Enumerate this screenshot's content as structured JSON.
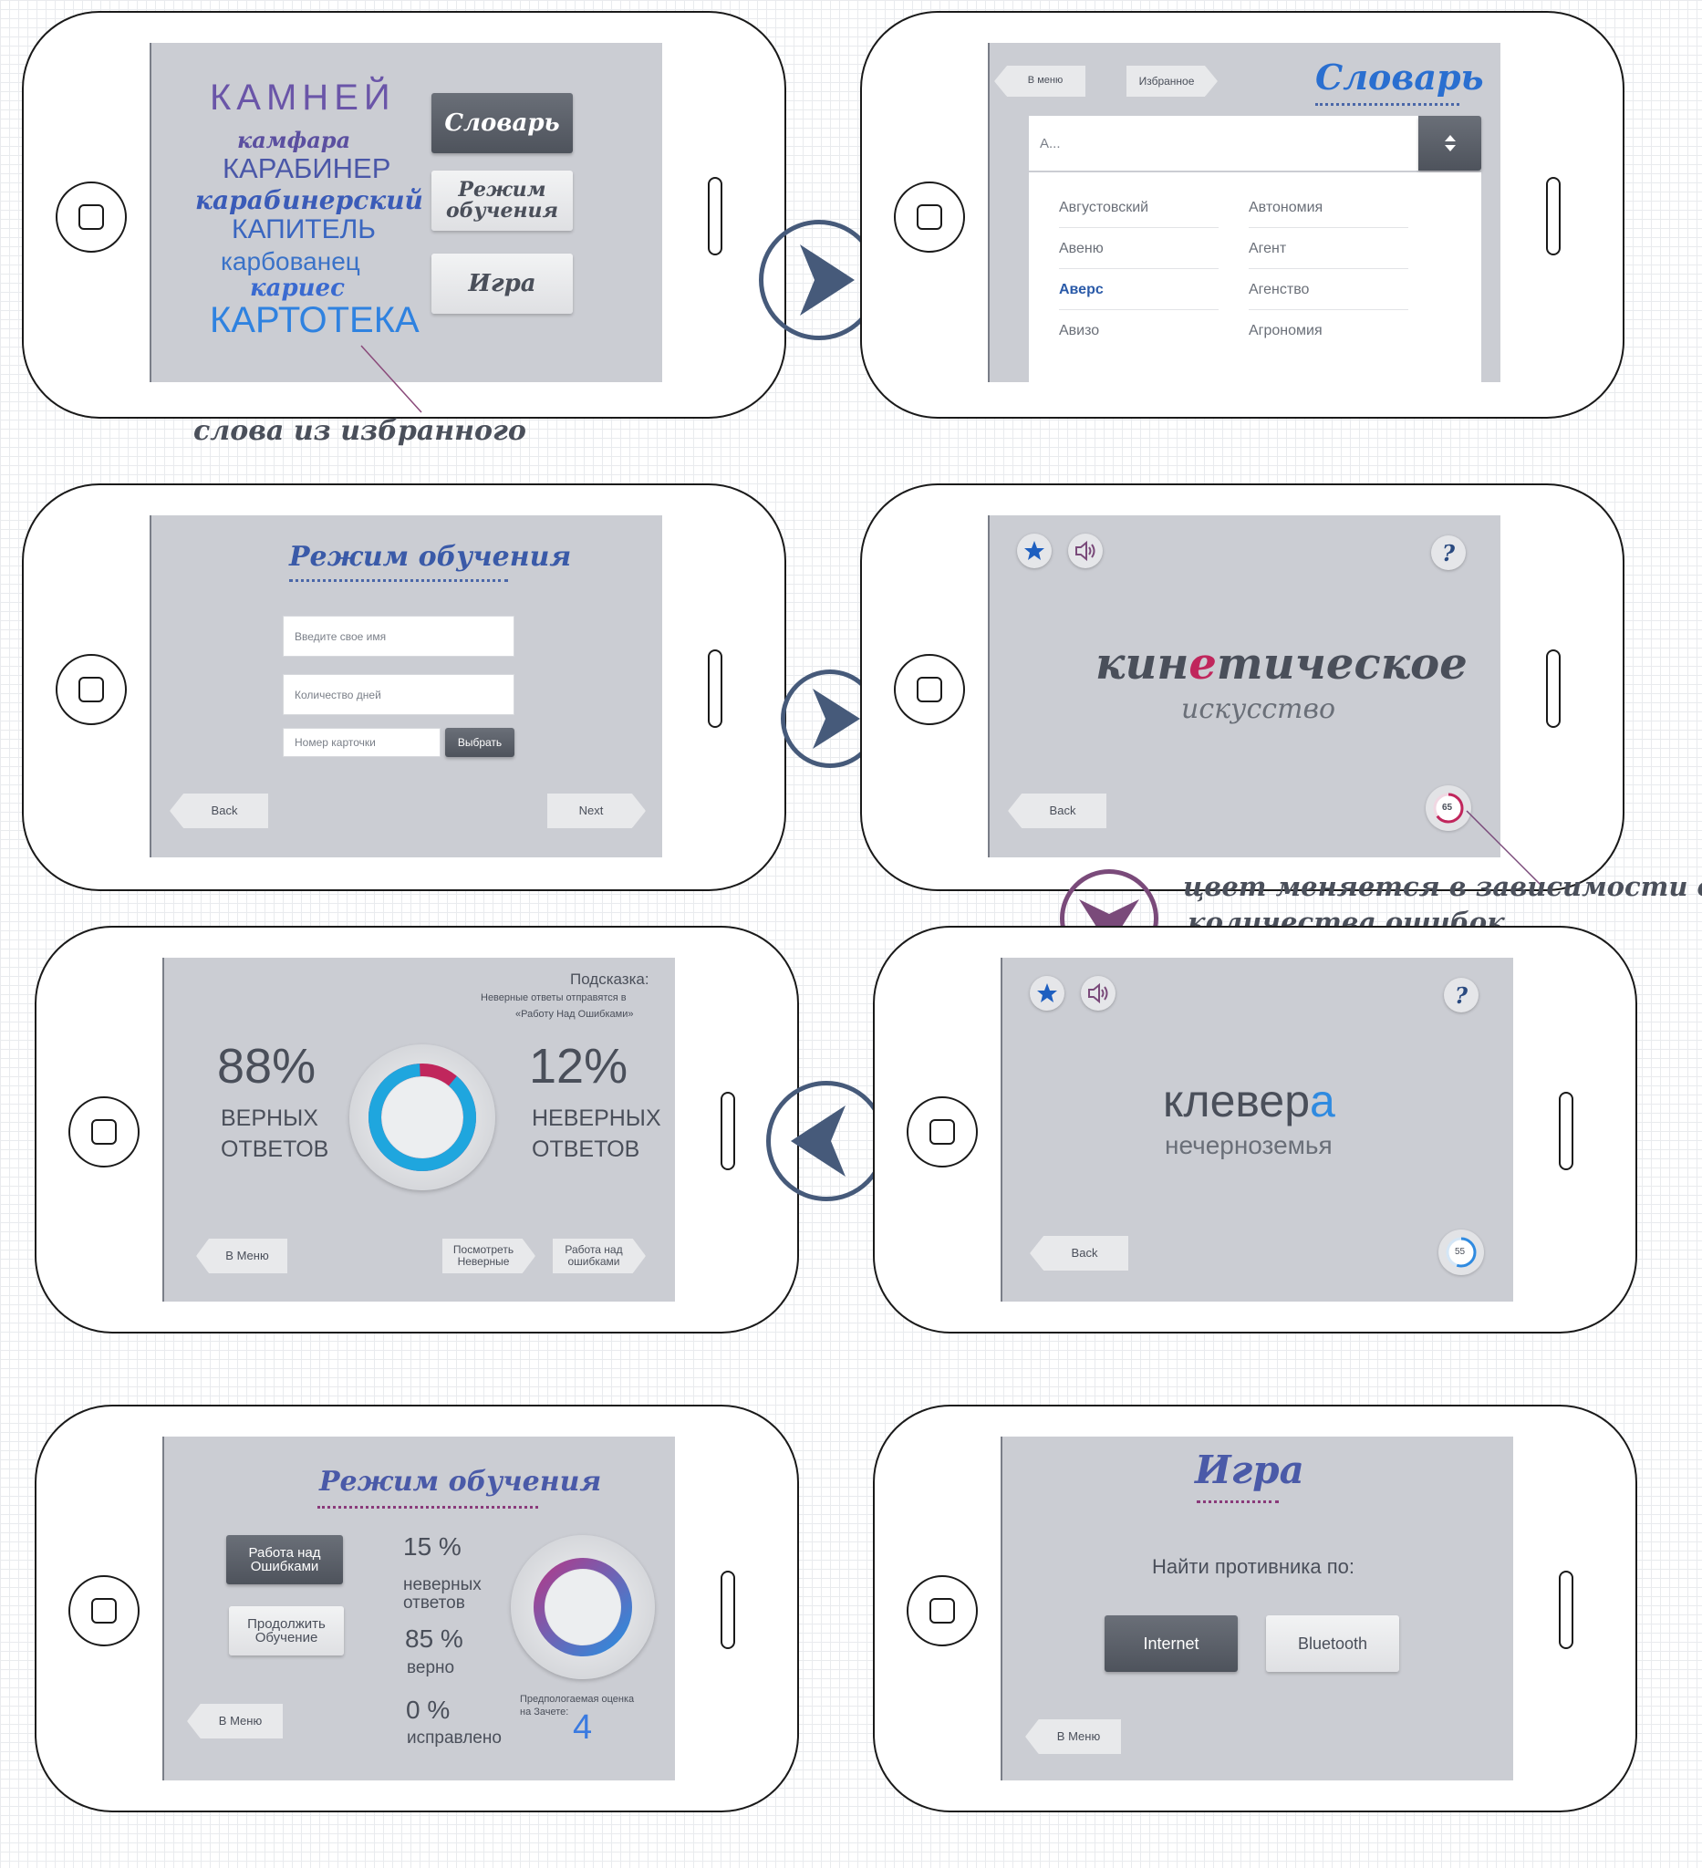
{
  "colors": {
    "screen_bg": "#cbcdd3",
    "accent_blue": "#2a6fd0",
    "dark_navy": "#465a7a",
    "crimson": "#c0265c",
    "purple": "#7a4a7a"
  },
  "annotations": {
    "favorites_note": "слова из избранного",
    "color_note_line1": "цвет меняется в зависимости от",
    "color_note_line2": "количества ошибок"
  },
  "screen1": {
    "words": [
      "КАМНЕЙ",
      "камфара",
      "КАРАБИНЕР",
      "карабинерский",
      "КАПИТЕЛЬ",
      "карбованец",
      "кариес",
      "КАРТОТЕКА"
    ],
    "dictionary_button": "Словарь",
    "learning_button_line1": "Режим",
    "learning_button_line2": "обучения",
    "game_button": "Игра"
  },
  "screen2": {
    "menu_button": "В меню",
    "favorites_button": "Избранное",
    "title": "Словарь",
    "search_value": "А...",
    "sort_icon": "sort-updown-icon",
    "col1": [
      "Августовский",
      "Авеню",
      "Аверс",
      "Авизо"
    ],
    "col2": [
      "Автономия",
      "Агент",
      "Агенство",
      "Агрономия"
    ],
    "selected": "Аверс"
  },
  "screen3": {
    "title": "Режим обучения",
    "name_placeholder": "Введите свое имя",
    "days_placeholder": "Количество дней",
    "card_placeholder": "Номер карточки",
    "choose_button": "Выбрать",
    "back_button": "Back",
    "next_button": "Next"
  },
  "screen4": {
    "word_part1": "кин",
    "word_highlight": "е",
    "word_part2": "тическое",
    "subword": "искусство",
    "help": "?",
    "back_button": "Back",
    "progress_value": "65",
    "progress_fraction": 0.65
  },
  "screen5": {
    "hint_title": "Подсказка:",
    "hint_line1": "Неверные ответы отправятся в",
    "hint_line2": "«Работу Над Ошибками»",
    "correct_percent": "88%",
    "correct_label_line1": "ВЕРНЫХ",
    "correct_label_line2": "ОТВЕТОВ",
    "wrong_percent": "12%",
    "wrong_label_line1": "НЕВЕРНЫХ",
    "wrong_label_line2": "ОТВЕТОВ",
    "correct_fraction": 0.88,
    "menu_button": "В Меню",
    "view_wrong_line1": "Посмотреть",
    "view_wrong_line2": "Неверные",
    "work_errors_line1": "Работа над",
    "work_errors_line2": "ошибками"
  },
  "screen6": {
    "word_part1": "клевер",
    "word_highlight": "а",
    "subword": "нечерноземья",
    "help": "?",
    "back_button": "Back",
    "progress_value": "55",
    "progress_fraction": 0.55
  },
  "screen7": {
    "title": "Режим обучения",
    "work_errors_line1": "Работа над",
    "work_errors_line2": "Ошибками",
    "continue_line1": "Продолжить",
    "continue_line2": "Обучение",
    "wrong_percent": "15 %",
    "wrong_label_line1": "неверных",
    "wrong_label_line2": "ответов",
    "correct_percent": "85 %",
    "correct_label": "верно",
    "fixed_percent": "0 %",
    "fixed_label": "исправлено",
    "grade_label_line1": "Предпологаемая оценка",
    "grade_label_line2": "на Зачете:",
    "grade_value": "4",
    "menu_button": "В Меню"
  },
  "screen8": {
    "title": "Игра",
    "find_label": "Найти противника по:",
    "internet_button": "Internet",
    "bluetooth_button": "Bluetooth",
    "menu_button": "В Меню"
  }
}
